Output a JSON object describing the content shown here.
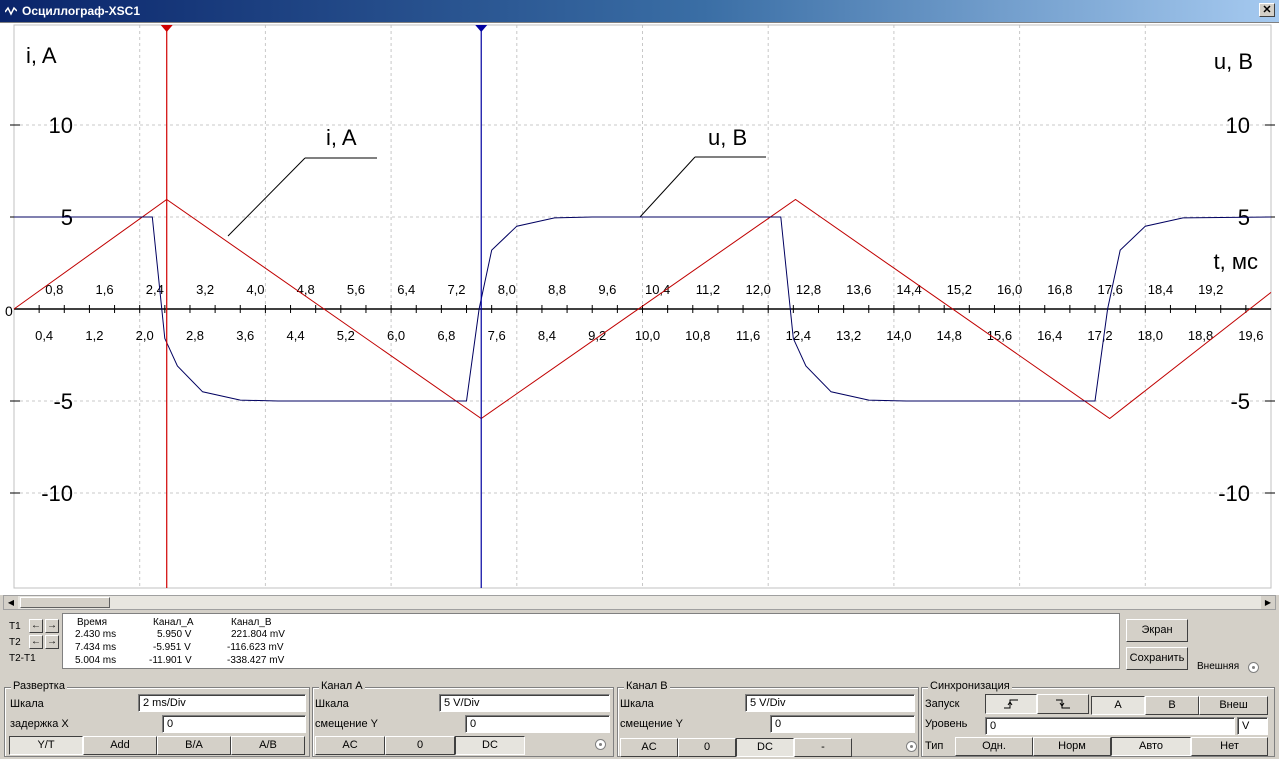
{
  "window": {
    "title": "Осциллограф-XSC1",
    "close_label": "✕"
  },
  "screen": {
    "left_axis_label": "i, A",
    "right_axis_label": "u, В",
    "time_axis_label": "t, мс",
    "origin_label": "0",
    "y_ticks": [
      "10",
      "5",
      "-5",
      "-10"
    ],
    "t_labels_top": [
      "0,8",
      "1,6",
      "2,4",
      "3,2",
      "4,0",
      "4,8",
      "5,6",
      "6,4",
      "7,2",
      "8,0",
      "8,8",
      "9,6",
      "10,4",
      "11,2",
      "12,0",
      "12,8",
      "13,6",
      "14,4",
      "15,2",
      "16,0",
      "16,8",
      "17,6",
      "18,4",
      "19,2"
    ],
    "t_labels_bottom": [
      "0,4",
      "1,2",
      "2,0",
      "2,8",
      "3,6",
      "4,4",
      "5,2",
      "6,0",
      "6,8",
      "7,6",
      "8,4",
      "9,2",
      "10,0",
      "10,8",
      "11,6",
      "12,4",
      "13,2",
      "14,0",
      "14,8",
      "15,6",
      "16,4",
      "17,2",
      "18,0",
      "18,8",
      "19,6"
    ],
    "annot_i": "i, A",
    "annot_u": "u, В",
    "cursor_t1_ms": 2.43,
    "cursor_t2_ms": 7.434
  },
  "chart_data": {
    "type": "line",
    "xlabel": "t, мс",
    "xlim": [
      0,
      20
    ],
    "ylim": [
      -15,
      15
    ],
    "series": [
      {
        "name": "i, A",
        "color": "#c00000",
        "x": [
          0,
          2.43,
          7.434,
          12.434,
          17.434,
          20
        ],
        "values": [
          0,
          5.95,
          -5.95,
          5.95,
          -5.95,
          0.9
        ]
      },
      {
        "name": "u, В",
        "color": "#000060",
        "x": [
          0,
          2.2,
          2.4,
          2.6,
          3.0,
          3.6,
          4.2,
          7.2,
          7.4,
          7.6,
          8.0,
          8.6,
          9.2,
          12.2,
          12.4,
          12.6,
          13.0,
          13.6,
          14.2,
          17.2,
          17.4,
          17.6,
          18.0,
          18.6,
          20
        ],
        "values": [
          5,
          5,
          -1.6,
          -3.1,
          -4.5,
          -4.95,
          -5,
          -5,
          0,
          3.2,
          4.5,
          4.95,
          5,
          5,
          -1.6,
          -3.1,
          -4.5,
          -4.95,
          -5,
          -5,
          0,
          3.2,
          4.5,
          4.95,
          5
        ]
      }
    ]
  },
  "readout": {
    "cursor_labels": [
      "T1",
      "T2",
      "T2-T1"
    ],
    "headers": [
      "Время",
      "Канал_A",
      "Канал_B"
    ],
    "rows": [
      [
        "2.430 ms",
        "5.950 V",
        "221.804 mV"
      ],
      [
        "7.434 ms",
        "-5.951 V",
        "-116.623 mV"
      ],
      [
        "5.004 ms",
        "-11.901 V",
        "-338.427 mV"
      ]
    ],
    "reverse_label": "Экран",
    "save_label": "Сохранить",
    "external_label": "Внешняя"
  },
  "timebase": {
    "title": "Развертка",
    "scale_label": "Шкала",
    "scale_value": "2 ms/Div",
    "delay_label": "задержка X",
    "delay_value": "0",
    "modes": [
      "Y/T",
      "Add",
      "B/A",
      "A/B"
    ],
    "active_mode": "Y/T"
  },
  "channel_a": {
    "title": "Канал A",
    "scale_label": "Шкала",
    "scale_value": "5  V/Div",
    "offset_label": "смещение Y",
    "offset_value": "0",
    "coupling": [
      "AC",
      "0",
      "DC"
    ],
    "active_coupling": "DC"
  },
  "channel_b": {
    "title": "Канал B",
    "scale_label": "Шкала",
    "scale_value": "5  V/Div",
    "offset_label": "смещение Y",
    "offset_value": "0",
    "coupling": [
      "AC",
      "0",
      "DC",
      "-"
    ],
    "active_coupling": "DC"
  },
  "trigger": {
    "title": "Синхронизация",
    "edge_label": "Запуск",
    "edges": [
      "rising-edge-icon",
      "falling-edge-icon"
    ],
    "sources": [
      "A",
      "B",
      "Внеш"
    ],
    "active_source": "A",
    "level_label": "Уровень",
    "level_value": "0",
    "level_unit": "V",
    "type_label": "Тип",
    "types": [
      "Одн.",
      "Норм",
      "Авто",
      "Нет"
    ],
    "active_type": "Авто"
  }
}
